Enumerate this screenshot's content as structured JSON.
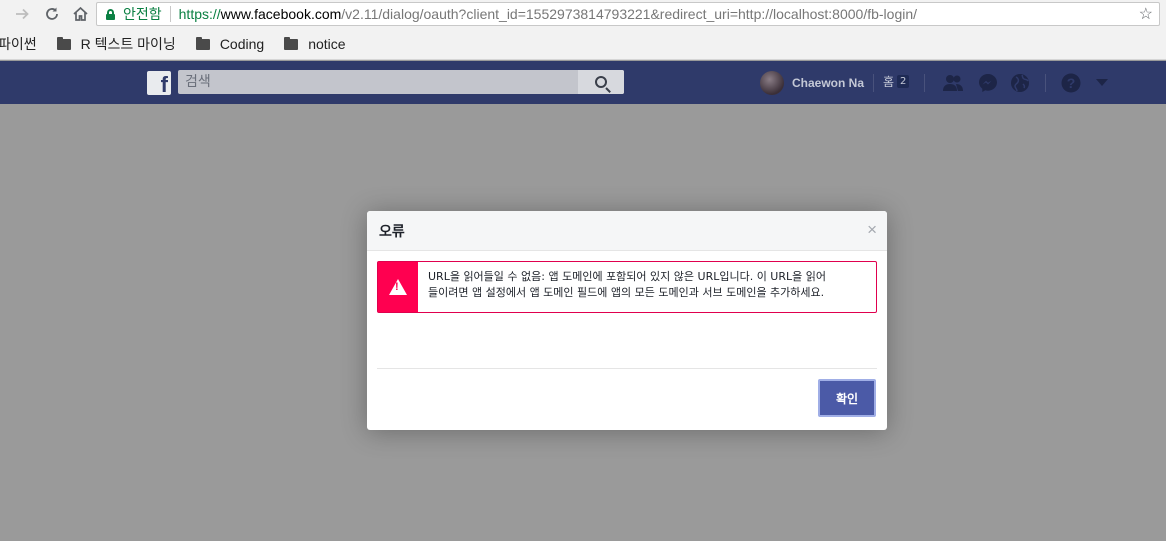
{
  "browser": {
    "secure_label": "안전함",
    "url_scheme": "https://",
    "url_host": "www.facebook.com",
    "url_path": "/v2.11/dialog/oauth?client_id=1552973814793221&redirect_uri=http://localhost:8000/fb-login/",
    "icons": {
      "back": "arrow-left-icon",
      "forward": "arrow-right-icon",
      "reload": "reload-icon",
      "home": "home-icon",
      "secure": "lock-icon",
      "bookmark_star": "star-icon"
    }
  },
  "bookmarks": [
    {
      "label": "파이썬",
      "icon": "folder-icon"
    },
    {
      "label": "R 텍스트 마이닝",
      "icon": "folder-icon"
    },
    {
      "label": "Coding",
      "icon": "folder-icon"
    },
    {
      "label": "notice",
      "icon": "folder-icon"
    }
  ],
  "facebook": {
    "search_placeholder": "검색",
    "user_name": "Chaewon Na",
    "home_label": "홈",
    "home_count": "2",
    "colors": {
      "bar": "#2f3a6a",
      "button": "#4b5aa7",
      "error": "#ff0050"
    }
  },
  "modal": {
    "title": "오류",
    "close_symbol": "×",
    "error_line1": "URL을 읽어들일 수 없음: 앱 도메인에 포함되어 있지 않은 URL입니다. 이 URL을 읽어",
    "error_line2": "들이려면 앱 설정에서 앱 도메인 필드에 앱의 모든 도메인과 서브 도메인을 추가하세요.",
    "confirm_label": "확인"
  }
}
